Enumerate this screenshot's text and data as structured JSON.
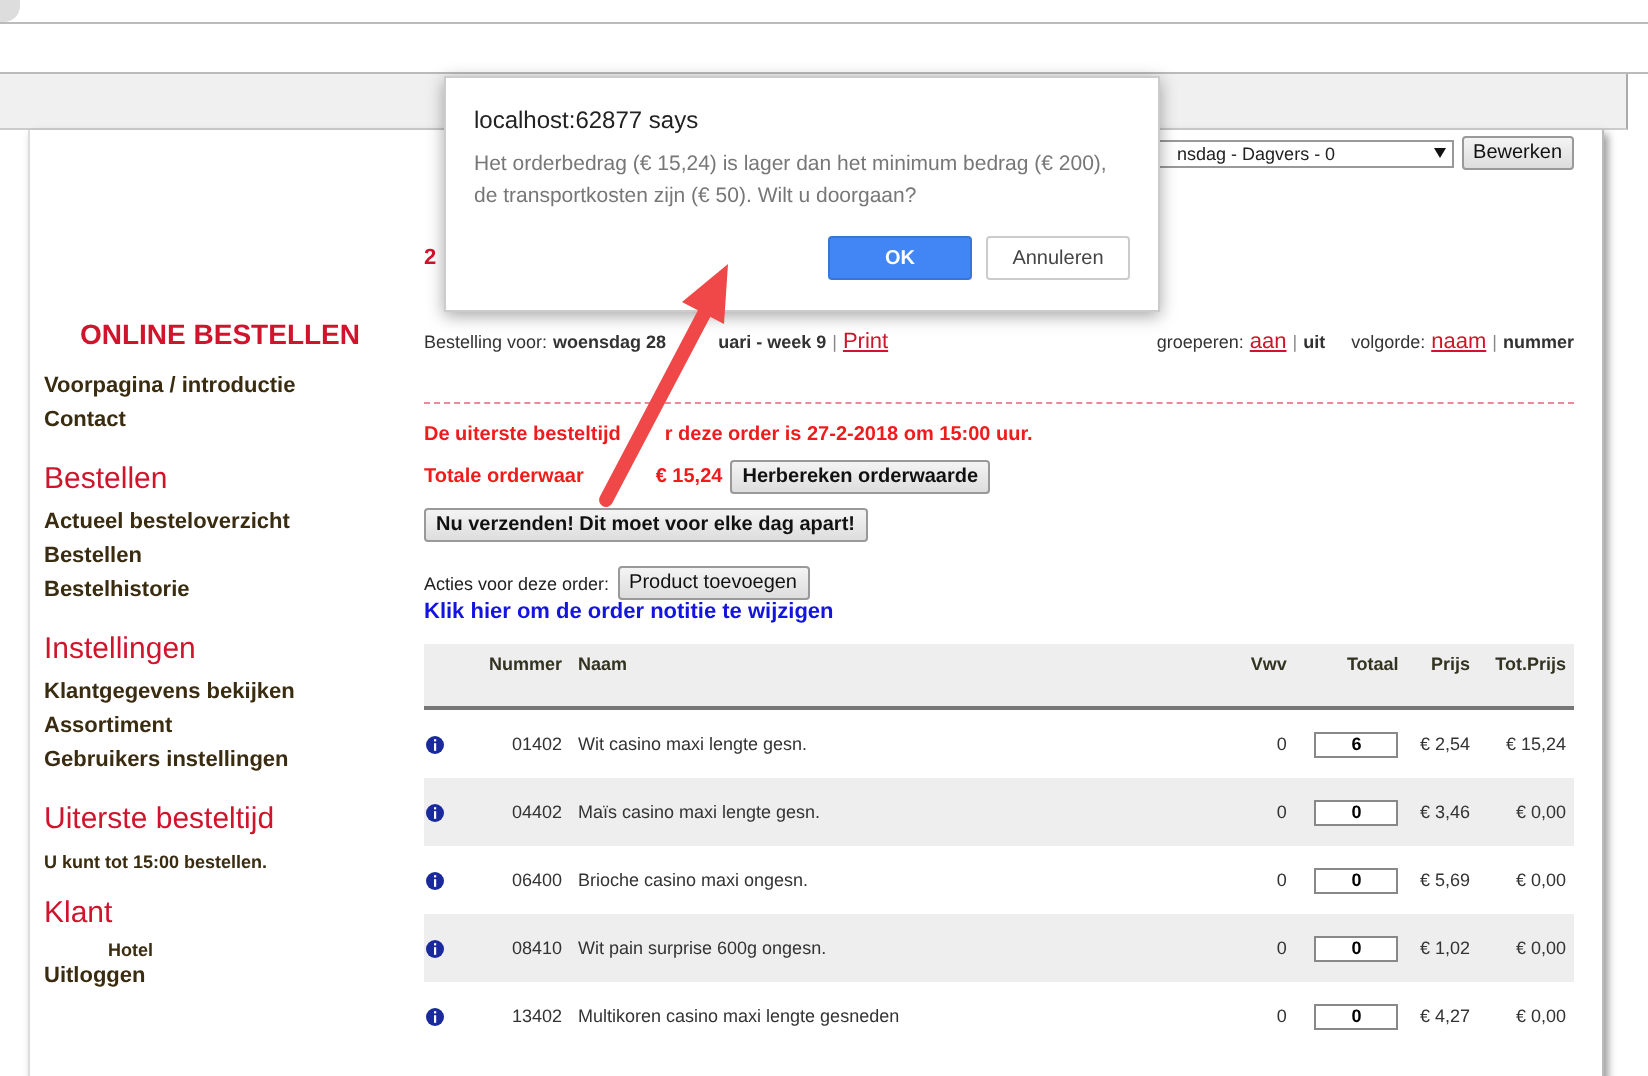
{
  "toolbar": {
    "dropdown": "nsdag - Dagvers - 0",
    "button": "Bewerken"
  },
  "partial_heading": "2",
  "sidebar": {
    "title": "ONLINE BESTELLEN",
    "sections": [
      {
        "items": [
          {
            "kind": "link",
            "text": "Voorpagina / introductie"
          },
          {
            "kind": "link",
            "text": "Contact"
          }
        ]
      },
      {
        "heading": "Bestellen",
        "items": [
          {
            "kind": "link",
            "text": "Actueel besteloverzicht"
          },
          {
            "kind": "link",
            "text": "Bestellen"
          },
          {
            "kind": "link",
            "text": "Bestelhistorie"
          }
        ]
      },
      {
        "heading": "Instellingen",
        "items": [
          {
            "kind": "link",
            "text": "Klantgegevens bekijken"
          },
          {
            "kind": "link",
            "text": "Assortiment"
          },
          {
            "kind": "link",
            "text": "Gebruikers instellingen"
          }
        ]
      },
      {
        "heading": "Uiterste besteltijd",
        "items": [
          {
            "kind": "note",
            "text": "U kunt tot 15:00 bestellen."
          }
        ]
      },
      {
        "heading": "Klant",
        "items": [
          {
            "kind": "customer",
            "text": "Hotel"
          },
          {
            "kind": "link",
            "text": "Uitloggen"
          }
        ]
      }
    ]
  },
  "order": {
    "label": "Bestelling voor:",
    "date_parts": [
      "woensdag 28",
      "uari - week 9"
    ],
    "separator": "|",
    "print": "Print",
    "grouping": {
      "label": "groeperen:",
      "options": [
        {
          "label": "aan",
          "selected": false
        },
        {
          "label": "uit",
          "selected": true
        }
      ]
    },
    "sorting": {
      "label": "volgorde:",
      "options": [
        {
          "label": "naam",
          "selected": false
        },
        {
          "label": "nummer",
          "selected": true
        }
      ]
    }
  },
  "deadline_parts": [
    "De uiterste besteltijd",
    "r deze order is 27-2-2018 om 15:00 uur."
  ],
  "total": {
    "label_parts": [
      "Totale orderwaar",
      "€ 15,24"
    ],
    "button": "Herbereken orderwaarde"
  },
  "send_button": "Nu verzenden! Dit moet voor elke dag apart!",
  "actions": {
    "label": "Acties voor deze order:",
    "button": "Product toevoegen"
  },
  "note_link": "Klik hier om de order notitie te wijzigen",
  "table": {
    "columns": [
      "Nummer",
      "Naam",
      "Vwv",
      "Totaal",
      "Prijs",
      "Tot.Prijs"
    ],
    "rows": [
      {
        "number": "01402",
        "name": "Wit casino maxi lengte gesn.",
        "vwv": "0",
        "total": "6",
        "price": "€ 2,54",
        "total_price": "€ 15,24"
      },
      {
        "number": "04402",
        "name": "Maïs casino maxi lengte gesn.",
        "vwv": "0",
        "total": "0",
        "price": "€ 3,46",
        "total_price": "€ 0,00"
      },
      {
        "number": "06400",
        "name": "Brioche casino maxi ongesn.",
        "vwv": "0",
        "total": "0",
        "price": "€ 5,69",
        "total_price": "€ 0,00"
      },
      {
        "number": "08410",
        "name": "Wit pain surprise 600g ongesn.",
        "vwv": "0",
        "total": "0",
        "price": "€ 1,02",
        "total_price": "€ 0,00"
      },
      {
        "number": "13402",
        "name": "Multikoren casino maxi lengte gesneden",
        "vwv": "0",
        "total": "0",
        "price": "€ 4,27",
        "total_price": "€ 0,00"
      }
    ]
  },
  "dialog": {
    "title": "localhost:62877 says",
    "message": "Het orderbedrag (€ 15,24) is lager dan het minimum bedrag (€ 200), de transportkosten zijn (€ 50). Wilt u doorgaan?",
    "buttons": [
      {
        "label": "OK",
        "kind": "primary"
      },
      {
        "label": "Annuleren",
        "kind": "secondary"
      }
    ]
  }
}
